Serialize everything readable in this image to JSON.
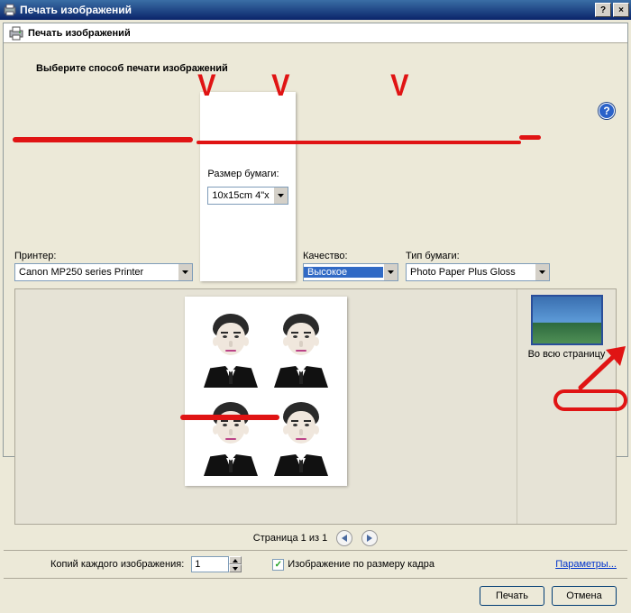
{
  "window": {
    "title": "Печать изображений",
    "help_glyph": "?",
    "close_glyph": "×"
  },
  "wizard": {
    "header_title": "Печать изображений",
    "instruction": "Выберите способ печати изображений"
  },
  "options": {
    "printer_label": "Принтер:",
    "printer_value": "Canon MP250 series Printer",
    "paper_size_label": "Размер бумаги:",
    "paper_size_value": "10x15cm 4\"x",
    "quality_label": "Качество:",
    "quality_value": "Высокое",
    "paper_type_label": "Тип бумаги:",
    "paper_type_value": "Photo Paper Plus Gloss"
  },
  "layouts": {
    "full_page_label": "Во всю страницу"
  },
  "pager": {
    "text": "Страница 1 из 1"
  },
  "copies": {
    "label": "Копий каждого изображения:",
    "value": "1"
  },
  "fit": {
    "label": "Изображение по размеру кадра",
    "checked": true
  },
  "params_link": "Параметры...",
  "buttons": {
    "print": "Печать",
    "cancel": "Отмена"
  }
}
